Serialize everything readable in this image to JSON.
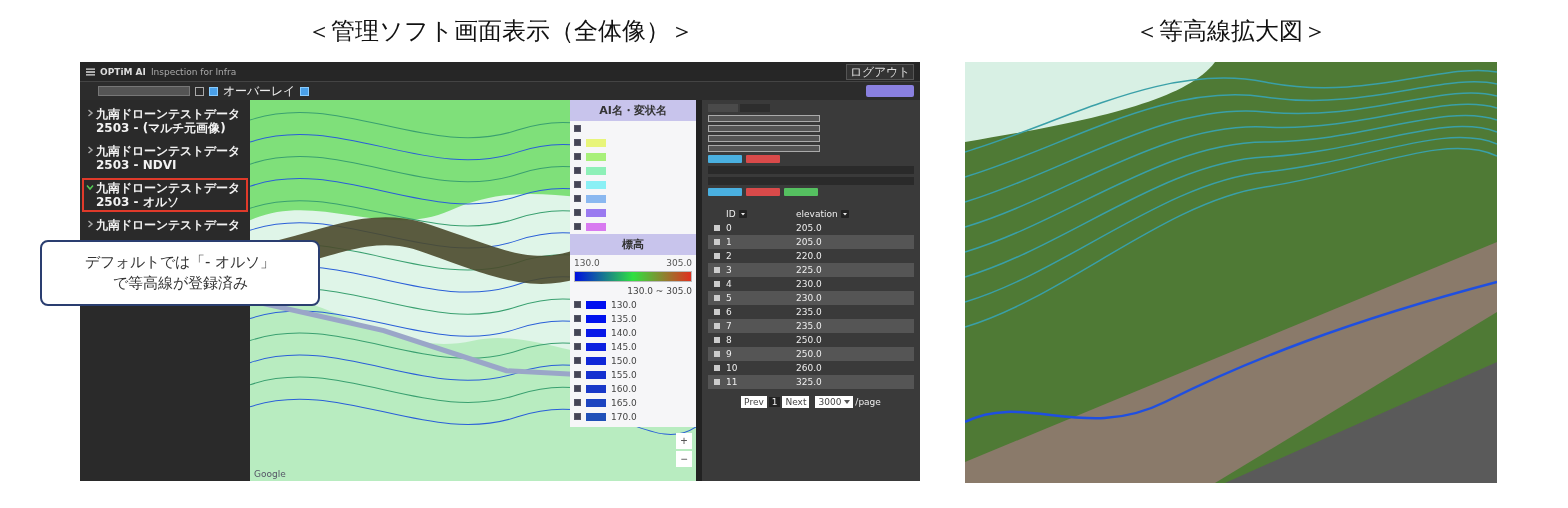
{
  "screenshot_panel": {
    "title": "＜管理ソフト画面表示（全体像）＞"
  },
  "zoom_panel": {
    "title": "＜等高線拡大図＞"
  },
  "app": {
    "brand": "OPTiM AI",
    "product": "Inspection for Infra",
    "logout": "ログアウト",
    "toolbar_checkboxes": [
      {
        "checked": false
      },
      {
        "label": "オーバーレイ",
        "checked": true
      },
      {
        "checked": true
      }
    ]
  },
  "sidebar": {
    "items": [
      {
        "line1": "九南ドローンテストデータ",
        "line2": "2503 - (マルチ元画像)",
        "expanded": false,
        "highlighted": false
      },
      {
        "line1": "九南ドローンテストデータ",
        "line2": "2503 - NDVI",
        "expanded": false,
        "highlighted": false
      },
      {
        "line1": "九南ドローンテストデータ",
        "line2": "2503 - オルソ",
        "expanded": true,
        "highlighted": true
      },
      {
        "line1": "九南ドローンテストデータ",
        "expanded": false,
        "highlighted": false
      }
    ]
  },
  "map": {
    "attribution": "Google",
    "zoom_in": "+",
    "zoom_out": "−"
  },
  "legend": {
    "title": "AI名・変状名",
    "items": [
      {
        "checked": true
      },
      {
        "color": "#e8f57a",
        "checked": true
      },
      {
        "color": "#a8f07a",
        "checked": true
      },
      {
        "color": "#8ef0b8",
        "checked": true
      },
      {
        "color": "#8af0f5",
        "checked": true
      },
      {
        "color": "#8ab8f0",
        "checked": true
      },
      {
        "color": "#9a7af0",
        "checked": true
      },
      {
        "color": "#d87af0",
        "checked": true
      }
    ],
    "elevation_title": "標高",
    "min": "130.0",
    "max": "305.0",
    "range": "130.0 ~ 305.0",
    "contours": [
      {
        "label": "130.0",
        "color": "#0010f0",
        "checked": true
      },
      {
        "label": "135.0",
        "color": "#0012ee",
        "checked": true
      },
      {
        "label": "140.0",
        "color": "#0818e8",
        "checked": true
      },
      {
        "label": "145.0",
        "color": "#0c20e0",
        "checked": true
      },
      {
        "label": "150.0",
        "color": "#1028d8",
        "checked": true
      },
      {
        "label": "155.0",
        "color": "#1430d0",
        "checked": true
      },
      {
        "label": "160.0",
        "color": "#1838c8",
        "checked": true
      },
      {
        "label": "165.0",
        "color": "#1c44c0",
        "checked": true
      },
      {
        "label": "170.0",
        "color": "#2050b8",
        "checked": true
      }
    ]
  },
  "table": {
    "columns": [
      "ID",
      "elevation"
    ],
    "rows": [
      {
        "id": "0",
        "value": "205.0",
        "checked": false
      },
      {
        "id": "1",
        "value": "205.0",
        "checked": false
      },
      {
        "id": "2",
        "value": "220.0",
        "checked": false
      },
      {
        "id": "3",
        "value": "225.0",
        "checked": false
      },
      {
        "id": "4",
        "value": "230.0",
        "checked": false
      },
      {
        "id": "5",
        "value": "230.0",
        "checked": false
      },
      {
        "id": "6",
        "value": "235.0",
        "checked": false
      },
      {
        "id": "7",
        "value": "235.0",
        "checked": false
      },
      {
        "id": "8",
        "value": "250.0",
        "checked": false
      },
      {
        "id": "9",
        "value": "250.0",
        "checked": false
      },
      {
        "id": "10",
        "value": "260.0",
        "checked": false
      },
      {
        "id": "11",
        "value": "325.0",
        "checked": false
      }
    ],
    "pagination": {
      "prev": "Prev",
      "page": "1",
      "next": "Next",
      "per_page": "3000",
      "suffix": "/page"
    }
  },
  "callout": {
    "lines": [
      "デフォルトでは「- オルソ」",
      "で等高線が登録済み"
    ]
  }
}
